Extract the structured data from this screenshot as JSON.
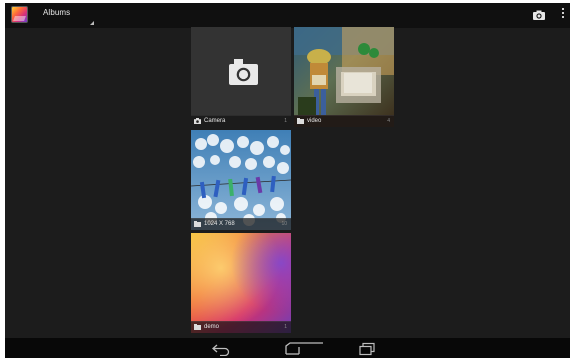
{
  "action_bar": {
    "spinner_label": "Albums",
    "app_icon": "gallery-app-icon",
    "camera_icon": "camera-icon",
    "overflow_icon": "overflow-menu-icon"
  },
  "albums": [
    {
      "label": "Camera",
      "count": "1",
      "icon": "camera-icon",
      "thumbnail": "camera-placeholder"
    },
    {
      "label": "video",
      "count": "4",
      "icon": "folder-icon",
      "thumbnail": "toy-story-scene"
    },
    {
      "label": "1024 X 768",
      "count": "10",
      "icon": "folder-icon",
      "thumbnail": "clothespins-on-line-sky"
    },
    {
      "label": "demo",
      "count": "1",
      "icon": "folder-icon",
      "thumbnail": "colorful-gradient"
    }
  ],
  "nav_bar": {
    "back_icon": "back-icon",
    "home_icon": "home-icon",
    "recents_icon": "recent-apps-icon"
  },
  "colors": {
    "background": "#1c1c1c",
    "action_bar": "#101010",
    "nav_bar": "#080808",
    "caption_text": "#e6e6e6"
  }
}
